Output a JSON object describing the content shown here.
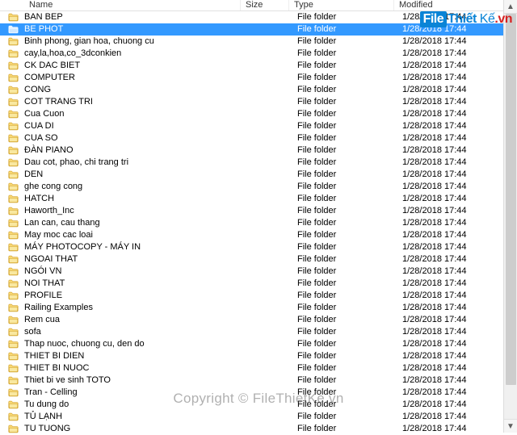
{
  "columns": {
    "name": "Name",
    "size": "Size",
    "type": "Type",
    "modified": "Modified"
  },
  "type_label": "File folder",
  "selected_index": 1,
  "rows": [
    {
      "name": "BAN BEP",
      "modified": "1/28/2018 17:44"
    },
    {
      "name": "BE PHOT",
      "modified": "1/28/2018 17:44"
    },
    {
      "name": "Binh phong, gian hoa, chuong cu",
      "modified": "1/28/2018 17:44"
    },
    {
      "name": "cay,la,hoa,co_3dconkien",
      "modified": "1/28/2018 17:44"
    },
    {
      "name": "CK DAC BIET",
      "modified": "1/28/2018 17:44"
    },
    {
      "name": "COMPUTER",
      "modified": "1/28/2018 17:44"
    },
    {
      "name": "CONG",
      "modified": "1/28/2018 17:44"
    },
    {
      "name": "COT TRANG TRI",
      "modified": "1/28/2018 17:44"
    },
    {
      "name": "Cua Cuon",
      "modified": "1/28/2018 17:44"
    },
    {
      "name": "CUA DI",
      "modified": "1/28/2018 17:44"
    },
    {
      "name": "CUA SO",
      "modified": "1/28/2018 17:44"
    },
    {
      "name": "ĐÀN PIANO",
      "modified": "1/28/2018 17:44"
    },
    {
      "name": "Dau cot, phao, chi trang tri",
      "modified": "1/28/2018 17:44"
    },
    {
      "name": "DEN",
      "modified": "1/28/2018 17:44"
    },
    {
      "name": "ghe cong cong",
      "modified": "1/28/2018 17:44"
    },
    {
      "name": "HATCH",
      "modified": "1/28/2018 17:44"
    },
    {
      "name": "Haworth_Inc",
      "modified": "1/28/2018 17:44"
    },
    {
      "name": "Lan can, cau thang",
      "modified": "1/28/2018 17:44"
    },
    {
      "name": "May moc cac loai",
      "modified": "1/28/2018 17:44"
    },
    {
      "name": "MÁY PHOTOCOPY - MÁY IN",
      "modified": "1/28/2018 17:44"
    },
    {
      "name": "NGOAI THAT",
      "modified": "1/28/2018 17:44"
    },
    {
      "name": "NGÓI VN",
      "modified": "1/28/2018 17:44"
    },
    {
      "name": "NOI THAT",
      "modified": "1/28/2018 17:44"
    },
    {
      "name": "PROFILE",
      "modified": "1/28/2018 17:44"
    },
    {
      "name": "Railing Examples",
      "modified": "1/28/2018 17:44"
    },
    {
      "name": "Rem cua",
      "modified": "1/28/2018 17:44"
    },
    {
      "name": "sofa",
      "modified": "1/28/2018 17:44"
    },
    {
      "name": "Thap nuoc, chuong cu, den do",
      "modified": "1/28/2018 17:44"
    },
    {
      "name": "THIET BI DIEN",
      "modified": "1/28/2018 17:44"
    },
    {
      "name": "THIET BI NUOC",
      "modified": "1/28/2018 17:44"
    },
    {
      "name": "Thiet bi ve sinh TOTO",
      "modified": "1/28/2018 17:44"
    },
    {
      "name": "Tran - Celling",
      "modified": "1/28/2018 17:44"
    },
    {
      "name": "Tu dung do",
      "modified": "1/28/2018 17:44"
    },
    {
      "name": "TỦ LẠNH",
      "modified": "1/28/2018 17:44"
    },
    {
      "name": "TU TUONG",
      "modified": "1/28/2018 17:44"
    }
  ],
  "watermark_logo": {
    "pre": "File",
    "mid": "Thiết",
    "post": "Kế",
    "tld": ".vn"
  },
  "watermark_center": "Copyright © FileThietKe.vn"
}
